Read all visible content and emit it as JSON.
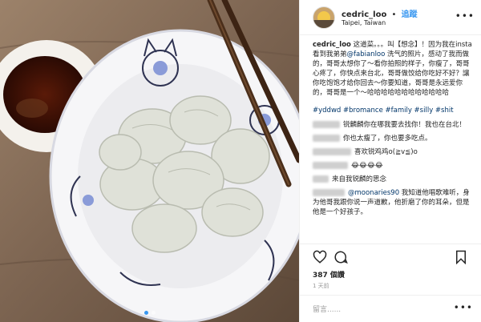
{
  "photo": {
    "carousel_dots": 2,
    "active_dot": 0
  },
  "header": {
    "username": "cedric_loo",
    "separator": "•",
    "follow": "追蹤",
    "location": "Taipei, Taiwan",
    "more": "•••"
  },
  "caption": {
    "username": "cedric_loo",
    "text_1": " 这道菜。。。叫【想念】！因为我在insta看到我弟弟",
    "mention": "@fabianloo",
    "text_2": " 洗气的照片，感动了我而做的，哥哥太想你了～看你拍照的样子，你瘦了，哥哥心疼了，你快点来台北，哥哥做饺给你吃好不好？讓你吃饱饱才给你回去～你要知道，哥哥是永远爱你的，哥哥是一个～哈哈哈哈哈哈哈哈哈哈哈哈"
  },
  "hashtags": "#yddwd #bromance #family #silly #shit",
  "comments": [
    {
      "text": "锐麟麟你在哪我要去找你！我也在台北！"
    },
    {
      "text": "你也太瘦了，你也要多吃点。"
    },
    {
      "text": "喜欢锐鸡鸡o(≧v≦)o"
    },
    {
      "text": "😂😂😂😂"
    },
    {
      "text": "来自我锐麟的思念"
    },
    {
      "mention": "@moonaries90",
      "text": " 我知道他唱歌难听，身为他哥我跟你说一声道歉，他折磨了你的耳朵，但是他是一个好孩子。"
    }
  ],
  "likes": "387 個讚",
  "time": "1 天前",
  "add_comment_placeholder": "留言......",
  "more_options": "•••"
}
